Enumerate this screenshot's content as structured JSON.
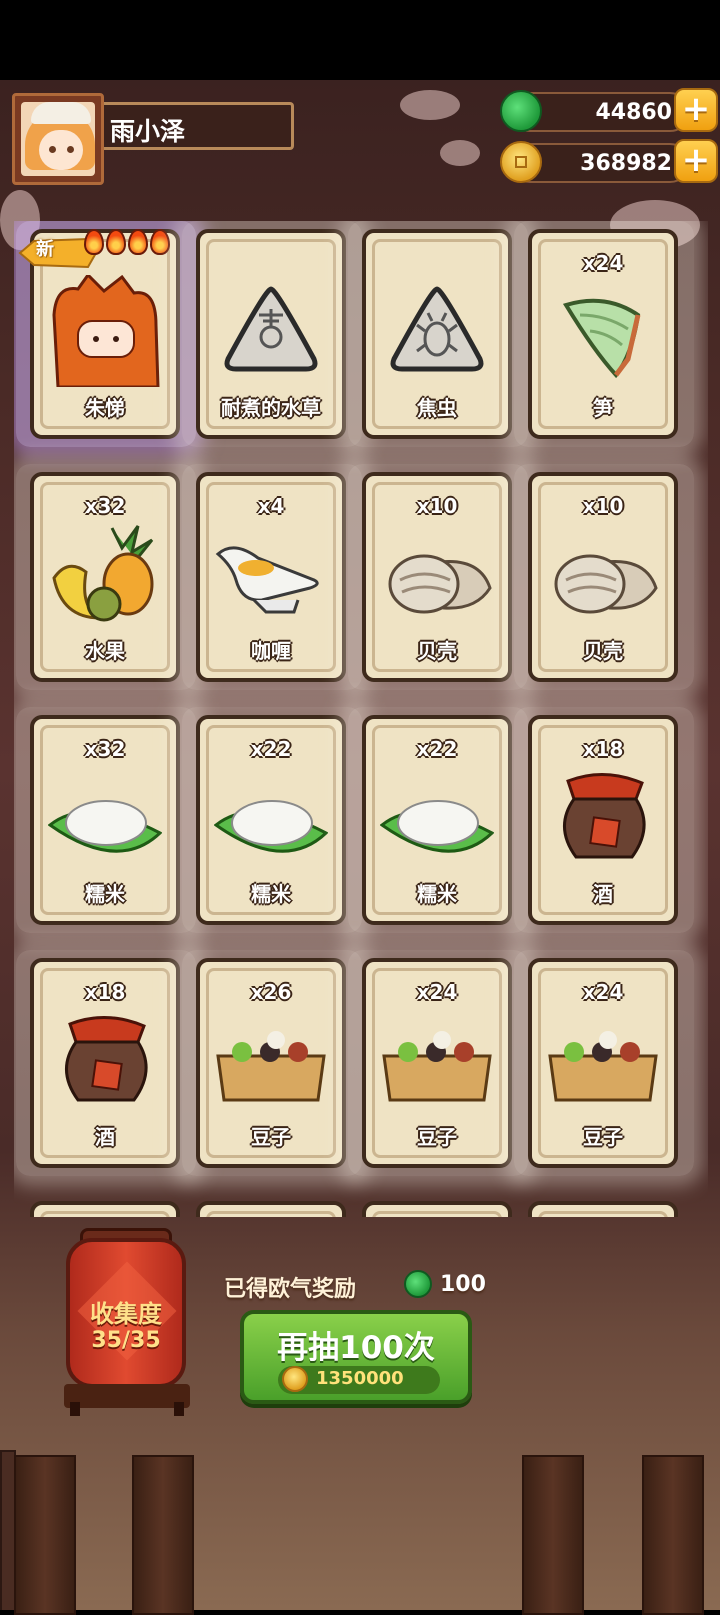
{
  "player": {
    "name": "雨小泽"
  },
  "currencies": [
    {
      "name": "jade",
      "value": "44860",
      "icon": "jade-icon"
    },
    {
      "name": "coins",
      "value": "368982",
      "icon": "coin-icon"
    }
  ],
  "new_badge": "新",
  "cards": [
    {
      "label": "朱悌",
      "qty": "",
      "icon": "zhuti-character-icon",
      "highlight": true,
      "flames": 4
    },
    {
      "label": "耐煮的水草",
      "qty": "",
      "icon": "locked-waterweed-icon"
    },
    {
      "label": "焦虫",
      "qty": "",
      "icon": "locked-bug-icon"
    },
    {
      "label": "笋",
      "qty": "x24",
      "icon": "bamboo-shoot-icon"
    },
    {
      "label": "水果",
      "qty": "x32",
      "icon": "fruit-icon"
    },
    {
      "label": "咖喱",
      "qty": "x4",
      "icon": "curry-icon"
    },
    {
      "label": "贝壳",
      "qty": "x10",
      "icon": "shell-icon"
    },
    {
      "label": "贝壳",
      "qty": "x10",
      "icon": "shell-icon"
    },
    {
      "label": "糯米",
      "qty": "x32",
      "icon": "sticky-rice-icon"
    },
    {
      "label": "糯米",
      "qty": "x22",
      "icon": "sticky-rice-icon"
    },
    {
      "label": "糯米",
      "qty": "x22",
      "icon": "sticky-rice-icon"
    },
    {
      "label": "酒",
      "qty": "x18",
      "icon": "wine-jar-icon"
    },
    {
      "label": "酒",
      "qty": "x18",
      "icon": "wine-jar-icon"
    },
    {
      "label": "豆子",
      "qty": "x26",
      "icon": "beans-box-icon"
    },
    {
      "label": "豆子",
      "qty": "x24",
      "icon": "beans-box-icon"
    },
    {
      "label": "豆子",
      "qty": "x24",
      "icon": "beans-box-icon"
    }
  ],
  "collection": {
    "title": "收集度",
    "count": "35/35"
  },
  "reward": {
    "label": "已得欧气奖励",
    "value": "100"
  },
  "draw_button": {
    "label": "再抽100次",
    "cost": "1350000"
  },
  "colors": {
    "jade": "#2fb34a",
    "coin": "#f0b020",
    "button_green": "#5aae2e",
    "card_bg": "#efe3c4"
  }
}
